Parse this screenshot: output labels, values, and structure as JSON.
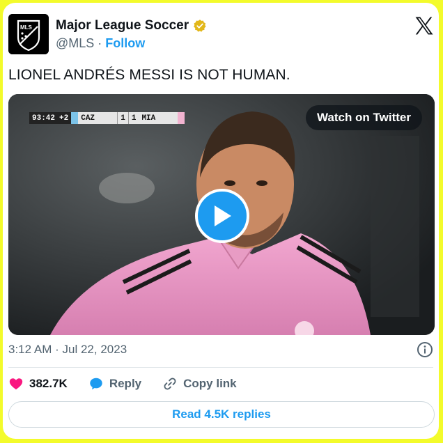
{
  "account": {
    "name": "Major League Soccer",
    "handle": "@MLS",
    "separator": "·",
    "follow_label": "Follow",
    "avatar_text": "MLS"
  },
  "tweet": {
    "text": "LIONEL ANDRÉS MESSI IS NOT HUMAN.",
    "time": "3:12 AM",
    "date": "Jul 22, 2023",
    "meta_separator": "·"
  },
  "media": {
    "watch_label": "Watch on Twitter",
    "scorebug": {
      "clock": "93:42",
      "added": "+2",
      "home_team": "CAZ",
      "home_score": "1",
      "away_score": "1",
      "away_team": "MIA"
    }
  },
  "actions": {
    "likes": "382.7K",
    "reply_label": "Reply",
    "copy_label": "Copy link",
    "read_replies_label": "Read 4.5K replies"
  },
  "colors": {
    "accent": "#1d9bf0",
    "like": "#f91880",
    "border": "#f3fb2b"
  },
  "icons": [
    "mls-logo-icon",
    "verified-badge-icon",
    "x-logo-icon",
    "play-icon",
    "info-icon",
    "heart-icon",
    "reply-bubble-icon",
    "link-icon"
  ]
}
